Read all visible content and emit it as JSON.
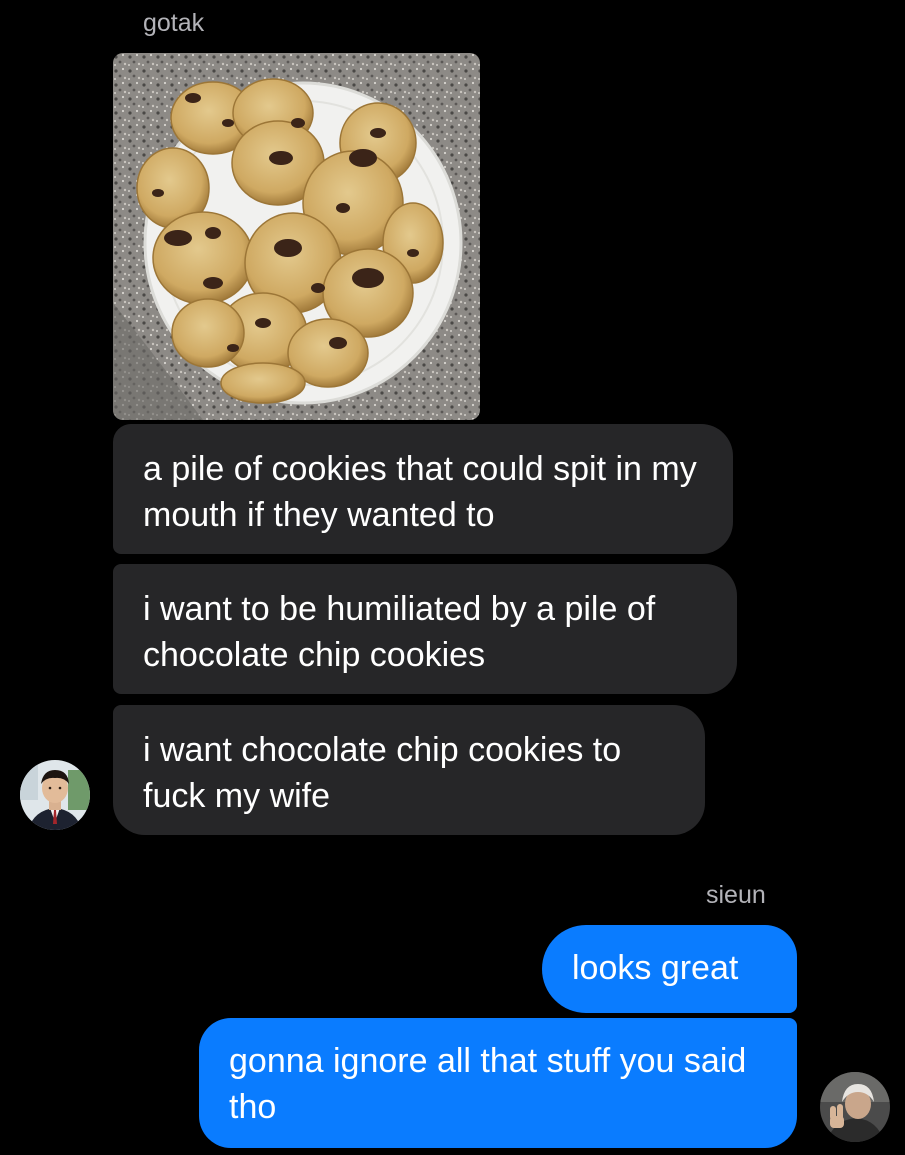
{
  "conversation": {
    "incoming": {
      "sender_name": "gotak",
      "avatar_icon": "profile-photo-gotak",
      "messages": [
        {
          "type": "image",
          "icon": "cookies-photo"
        },
        {
          "type": "text",
          "text": "a pile of cookies that could spit in my mouth if they wanted to"
        },
        {
          "type": "text",
          "text": "i want to be humiliated by a pile of chocolate chip cookies"
        },
        {
          "type": "text",
          "text": "i want chocolate chip cookies to fuck my wife"
        }
      ]
    },
    "outgoing": {
      "sender_name": "sieun",
      "avatar_icon": "profile-photo-sieun",
      "messages": [
        {
          "type": "text",
          "text": "looks great"
        },
        {
          "type": "text",
          "text": "gonna ignore all that stuff you said tho"
        }
      ]
    }
  },
  "colors": {
    "background": "#000000",
    "incoming_bubble": "#262628",
    "outgoing_bubble": "#0a7cff",
    "sender_name": "#b3b3b8"
  }
}
